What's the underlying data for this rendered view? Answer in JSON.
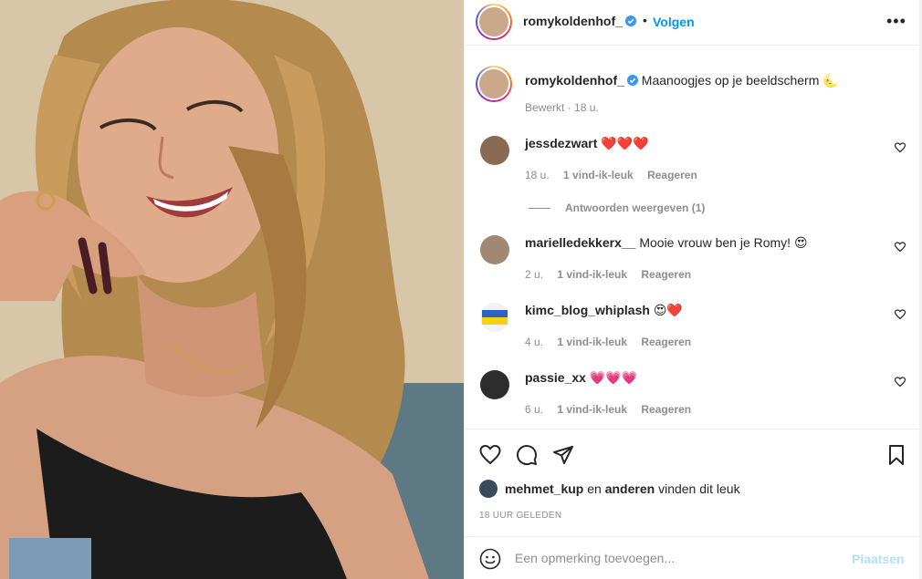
{
  "header": {
    "username": "romykoldenhof_",
    "separator": "•",
    "follow_label": "Volgen",
    "more_label": "•••"
  },
  "caption": {
    "username": "romykoldenhof_",
    "text": "Maanoogjes op je beeldscherm 🌜",
    "edited": "Bewerkt",
    "time": "· 18 u."
  },
  "comments": [
    {
      "username": "jessdezwart",
      "text": "❤️❤️❤️",
      "time": "18 u.",
      "likes": "1 vind-ik-leuk",
      "reply": "Reageren"
    },
    {
      "username": "marielledekkerx__",
      "text": "Mooie vrouw ben je Romy! 😍",
      "time": "2 u.",
      "likes": "1 vind-ik-leuk",
      "reply": "Reageren"
    },
    {
      "username": "kimc_blog_whiplash",
      "text": "😍❤️",
      "time": "4 u.",
      "likes": "1 vind-ik-leuk",
      "reply": "Reageren"
    },
    {
      "username": "passie_xx",
      "text": "💗💗💗",
      "time": "6 u.",
      "likes": "1 vind-ik-leuk",
      "reply": "Reageren"
    }
  ],
  "replies_label": "Antwoorden weergeven (1)",
  "likes": {
    "user": "mehmet_kup",
    "connector": "en",
    "others": "anderen",
    "suffix": "vinden dit leuk"
  },
  "timestamp": "18 UUR GELEDEN",
  "add_comment": {
    "placeholder": "Een opmerking toevoegen...",
    "post_label": "Plaatsen"
  },
  "colors": {
    "accent": "#0095f6",
    "disabled_accent": "#b2dffc",
    "secondary_text": "#8e8e8e",
    "verified": "#3897f0"
  },
  "icons": [
    "verified-icon",
    "more-icon",
    "heart-icon",
    "comment-icon",
    "share-icon",
    "bookmark-icon",
    "emoji-icon"
  ]
}
